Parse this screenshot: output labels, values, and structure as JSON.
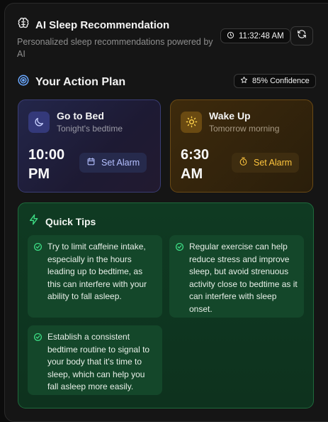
{
  "header": {
    "title": "AI Sleep Recommendation",
    "subtitle": "Personalized sleep recommendations powered by AI",
    "time": "11:32:48 AM"
  },
  "plan": {
    "title": "Your Action Plan",
    "confidence": "85% Confidence"
  },
  "bed": {
    "title": "Go to Bed",
    "subtitle": "Tonight's bedtime",
    "time_line1": "10:00",
    "time_line2": "PM",
    "button": "Set Alarm"
  },
  "wake": {
    "title": "Wake Up",
    "subtitle": "Tomorrow morning",
    "time_line1": "6:30",
    "time_line2": "AM",
    "button": "Set Alarm"
  },
  "tips": {
    "title": "Quick Tips",
    "items": [
      "Try to limit caffeine intake, especially in the hours leading up to bedtime, as this can interfere with your ability to fall asleep.",
      "Regular exercise can help reduce stress and improve sleep, but avoid strenuous activity close to bedtime as it can interfere with sleep onset.",
      "Establish a consistent bedtime routine to signal to your body that it's time to sleep, which can help you fall asleep more easily."
    ]
  },
  "colors": {
    "bed_accent": "#b4c0ff",
    "wake_accent": "#ffc53d",
    "tips_accent": "#3ddc84"
  }
}
